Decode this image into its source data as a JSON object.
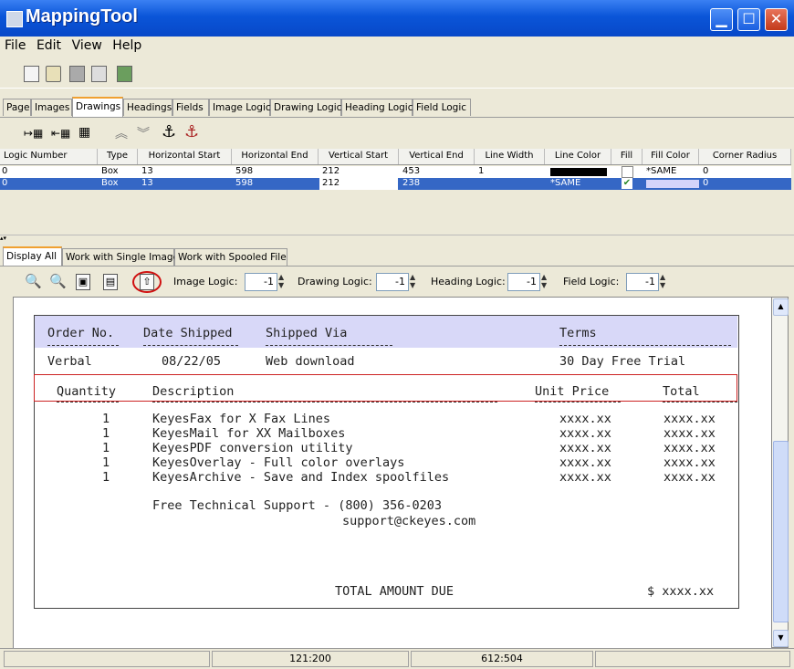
{
  "window": {
    "title": "MappingTool"
  },
  "menu": [
    "File",
    "Edit",
    "View",
    "Help"
  ],
  "top_tabs": [
    "Page",
    "Images",
    "Drawings",
    "Headings",
    "Fields",
    "Image Logic",
    "Drawing Logic",
    "Heading Logic",
    "Field Logic"
  ],
  "active_top_tab": "Drawings",
  "table": {
    "headers": [
      "Logic Number",
      "Type",
      "Horizontal Start",
      "Horizontal End",
      "Vertical Start",
      "Vertical End",
      "Line Width",
      "Line Color",
      "Fill",
      "Fill Color",
      "Corner Radius"
    ],
    "rows": [
      {
        "logic": "0",
        "type": "Box",
        "hstart": "13",
        "hend": "598",
        "vstart": "212",
        "vend": "453",
        "lwidth": "1",
        "lcolor": "",
        "fill": "",
        "fcolor": "*SAME",
        "radius": "0"
      },
      {
        "logic": "0",
        "type": "Box",
        "hstart": "13",
        "hend": "598",
        "vstart": "212",
        "vend": "238",
        "lwidth": "",
        "lcolor": "*SAME",
        "fill": "✔",
        "fcolor": "",
        "radius": "0"
      }
    ]
  },
  "bottom_tabs": [
    "Display All",
    "Work with Single Image",
    "Work with Spooled File"
  ],
  "active_bottom_tab": "Display All",
  "logic_controls": {
    "image_label": "Image Logic:",
    "image_value": "-1",
    "drawing_label": "Drawing Logic:",
    "drawing_value": "-1",
    "heading_label": "Heading Logic:",
    "heading_value": "-1",
    "field_label": "Field Logic:",
    "field_value": "-1"
  },
  "document": {
    "header_cols": {
      "order": "Order No.",
      "date": "Date Shipped",
      "via": "Shipped Via",
      "terms": "Terms"
    },
    "header_vals": {
      "order": "Verbal",
      "date": "08/22/05",
      "via": "Web download",
      "terms": "30 Day Free Trial"
    },
    "item_cols": {
      "qty": "Quantity",
      "desc": "Description",
      "price": "Unit Price",
      "total": "Total"
    },
    "items": [
      {
        "qty": "1",
        "desc": "KeyesFax for X Fax Lines",
        "price": "xxxx.xx",
        "total": "xxxx.xx"
      },
      {
        "qty": "1",
        "desc": "KeyesMail for XX Mailboxes",
        "price": "xxxx.xx",
        "total": "xxxx.xx"
      },
      {
        "qty": "1",
        "desc": "KeyesPDF conversion utility",
        "price": "xxxx.xx",
        "total": "xxxx.xx"
      },
      {
        "qty": "1",
        "desc": "KeyesOverlay - Full color overlays",
        "price": "xxxx.xx",
        "total": "xxxx.xx"
      },
      {
        "qty": "1",
        "desc": "KeyesArchive - Save and Index spoolfiles",
        "price": "xxxx.xx",
        "total": "xxxx.xx"
      }
    ],
    "support_line1": "Free Technical Support - (800) 356-0203",
    "support_line2": "support@ckeyes.com",
    "total_label": "TOTAL AMOUNT DUE",
    "total_value": "$ xxxx.xx"
  },
  "status": {
    "left": "",
    "pos1": "121:200",
    "pos2": "612:504",
    "right": ""
  },
  "colors": {
    "title_bar": "#0a55d8",
    "selection": "#3567c5",
    "header_fill": "#d8d8f8",
    "highlight_box": "#cc2222"
  }
}
